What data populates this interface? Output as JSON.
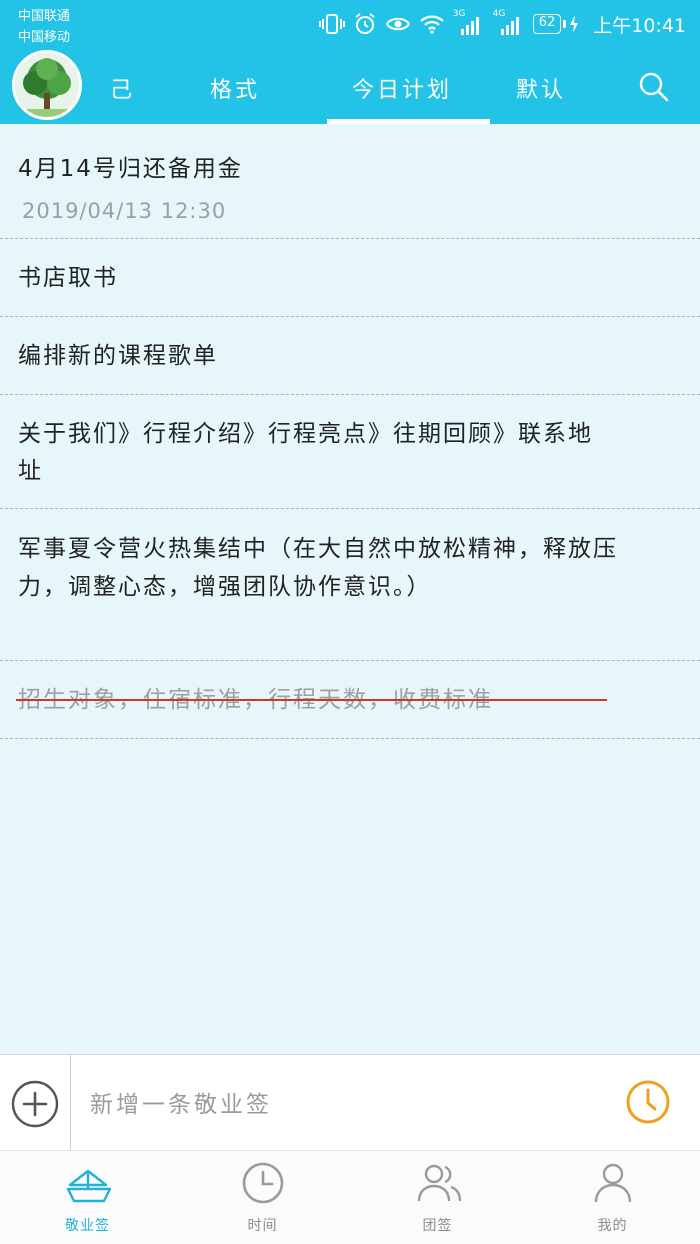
{
  "status_bar": {
    "carrier_1": "中国联通",
    "carrier_2": "中国移动",
    "network_1": "3G",
    "network_2": "4G",
    "battery": "62",
    "time": "上午10:41"
  },
  "header": {
    "tabs": [
      {
        "label": "己"
      },
      {
        "label": "格式"
      },
      {
        "label": "今日计划",
        "active": true
      },
      {
        "label": "默认"
      }
    ],
    "accent_color": "#22c3e6"
  },
  "notes": [
    {
      "text": "4月14号归还备用金",
      "date": "2019/04/13  12:30"
    },
    {
      "text": "书店取书"
    },
    {
      "text": "编排新的课程歌单"
    },
    {
      "text": "关于我们》行程介绍》行程亮点》往期回顾》联系地址"
    },
    {
      "text": "军事夏令营火热集结中（在大自然中放松精神，释放压力，调整心态，增强团队协作意识。）"
    },
    {
      "text": "招生对象，住宿标准，行程天数，收费标准",
      "completed": true
    }
  ],
  "input_bar": {
    "placeholder": "新增一条敬业签",
    "alarm_color": "#f0a020"
  },
  "bottom_nav": [
    {
      "label": "敬业签",
      "icon": "boat-icon",
      "active": true
    },
    {
      "label": "时间",
      "icon": "clock-icon"
    },
    {
      "label": "团签",
      "icon": "team-icon"
    },
    {
      "label": "我的",
      "icon": "person-icon"
    }
  ]
}
